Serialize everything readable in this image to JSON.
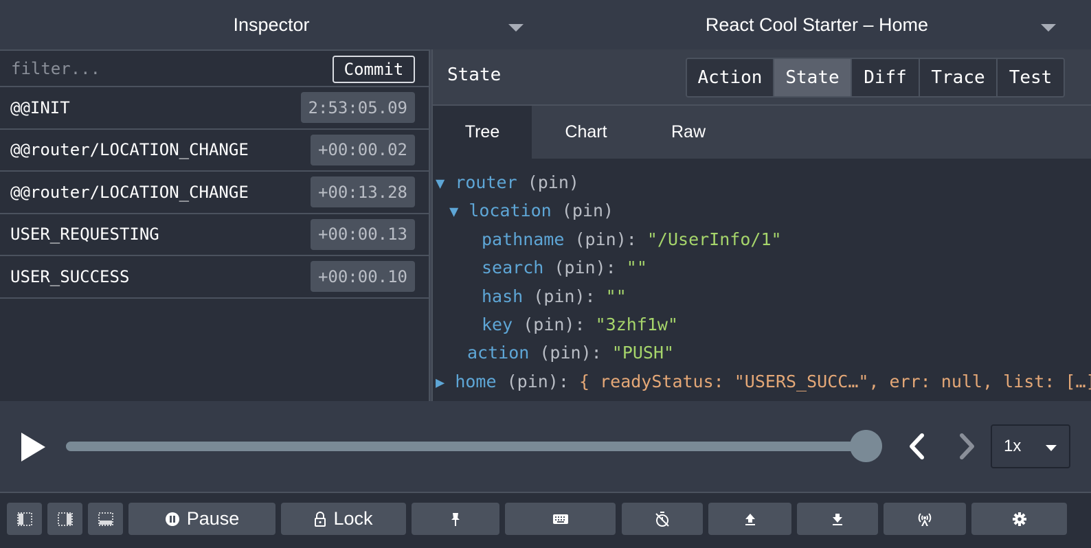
{
  "header": {
    "monitor_select": "Inspector",
    "instance_select": "React Cool Starter – Home"
  },
  "actions_panel": {
    "filter_placeholder": "filter...",
    "commit_label": "Commit",
    "items": [
      {
        "name": "@@INIT",
        "time": "2:53:05.09"
      },
      {
        "name": "@@router/LOCATION_CHANGE",
        "time": "+00:00.02"
      },
      {
        "name": "@@router/LOCATION_CHANGE",
        "time": "+00:13.28"
      },
      {
        "name": "USER_REQUESTING",
        "time": "+00:00.13"
      },
      {
        "name": "USER_SUCCESS",
        "time": "+00:00.10"
      }
    ]
  },
  "inspector": {
    "title": "State",
    "tabs": [
      "Action",
      "State",
      "Diff",
      "Trace",
      "Test"
    ],
    "active_tab": "State",
    "subtabs": [
      "Tree",
      "Chart",
      "Raw"
    ],
    "active_subtab": "Tree",
    "tree": {
      "arrow_expanded": "▼",
      "arrow_collapsed": "▶",
      "pin": "(pin)",
      "colon": ":",
      "router": "router",
      "location": "location",
      "pathname": "pathname",
      "pathname_value": "\"/UserInfo/1\"",
      "search": "search",
      "search_value": "\"\"",
      "hash": "hash",
      "hash_value": "\"\"",
      "key": "key",
      "key_value": "\"3zhf1w\"",
      "action": "action",
      "action_value": "\"PUSH\"",
      "home": "home",
      "home_preview": "{ readyStatus: \"USERS_SUCC…\", err: null, list: […] }"
    }
  },
  "slider": {
    "progress": 1.0,
    "speed": "1x"
  },
  "toolbar": {
    "pause_label": "Pause",
    "lock_label": "Lock"
  },
  "colors": {
    "background": "#2a2f3a",
    "header": "#353b48",
    "key": "#5ea6d6",
    "string": "#a6d56b",
    "object_preview": "#e5a877",
    "slider": "#7a8a96"
  }
}
